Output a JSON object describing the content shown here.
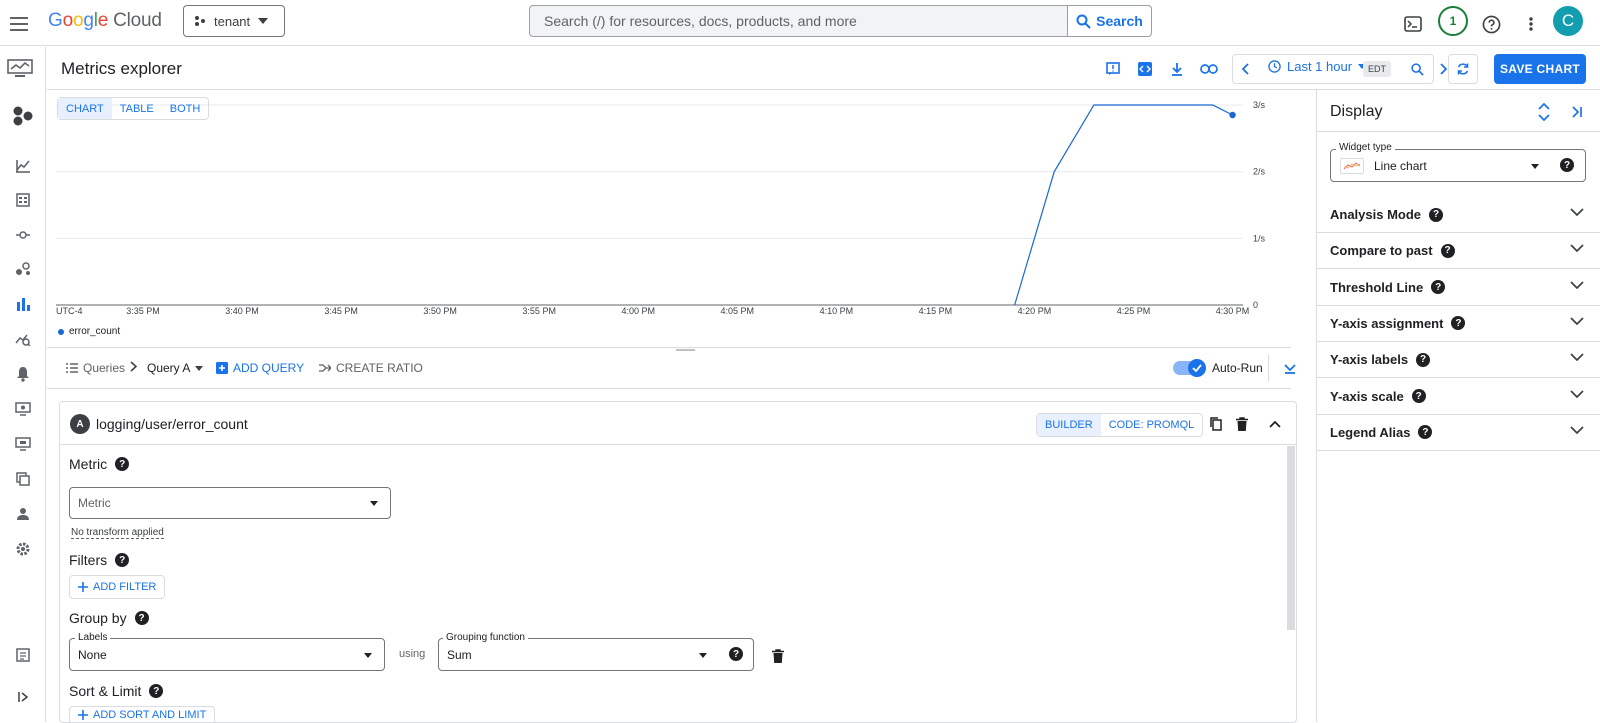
{
  "topbar": {
    "logo_parts": [
      "G",
      "o",
      "o",
      "g",
      "l",
      "e"
    ],
    "logo_cloud": "Cloud",
    "project": "tenant",
    "search_placeholder": "Search (/) for resources, docs, products, and more",
    "search_button": "Search",
    "notification_count": "1",
    "avatar_letter": "C",
    "icons": [
      "menu-icon",
      "terminal-icon",
      "help-icon",
      "more-vert-icon"
    ]
  },
  "rail": {
    "icons": [
      "monitoring-logo-icon",
      "overview-icon",
      "dashboards-icon",
      "metrics-scope-icon",
      "integrations-icon",
      "services-icon",
      "metrics-explorer-icon",
      "slo-icon",
      "alerting-icon",
      "uptime-icon",
      "synthetic-icon",
      "groups-icon",
      "user-icon",
      "settings-icon",
      "release-notes-icon",
      "expand-rail-icon"
    ]
  },
  "header": {
    "title": "Metrics explorer",
    "time_range": "Last 1 hour",
    "timezone": "EDT",
    "save_chart": "SAVE CHART"
  },
  "view_tabs": [
    "CHART",
    "TABLE",
    "BOTH"
  ],
  "chart_data": {
    "type": "line",
    "x": [
      "4:19 PM",
      "4:21 PM",
      "4:23 PM",
      "4:29 PM",
      "4:30 PM"
    ],
    "series": [
      {
        "name": "error_count",
        "values": [
          0,
          2,
          3,
          3,
          2.85
        ]
      }
    ],
    "x_tick_labels": [
      "UTC-4",
      "3:35 PM",
      "3:40 PM",
      "3:45 PM",
      "3:50 PM",
      "3:55 PM",
      "4:00 PM",
      "4:05 PM",
      "4:10 PM",
      "4:15 PM",
      "4:20 PM",
      "4:25 PM",
      "4:30 PM"
    ],
    "y_tick_labels": [
      "3/s",
      "2/s",
      "1/s",
      "0"
    ],
    "ylim": [
      0,
      3
    ],
    "grid": true,
    "legend_position": "bottom-left",
    "color": "#1967d2"
  },
  "query_bar": {
    "queries_label": "Queries",
    "query_name": "Query A",
    "add_query": "ADD QUERY",
    "create_ratio": "CREATE RATIO",
    "auto_run": "Auto-Run"
  },
  "query": {
    "badge": "A",
    "name": "logging/user/error_count",
    "modes": [
      "BUILDER",
      "CODE: PROMQL"
    ],
    "metric_label": "Metric",
    "metric_placeholder": "Metric",
    "transform": "No transform applied",
    "filters_label": "Filters",
    "add_filter": "ADD FILTER",
    "group_by_label": "Group by",
    "labels_field": "Labels",
    "labels_value": "None",
    "using": "using",
    "grouping_field": "Grouping function",
    "grouping_value": "Sum",
    "sort_label": "Sort & Limit",
    "add_sort": "ADD SORT AND LIMIT"
  },
  "display": {
    "title": "Display",
    "widget_type_label": "Widget type",
    "widget_type_value": "Line chart",
    "sections": [
      "Analysis Mode",
      "Compare to past",
      "Threshold Line",
      "Y-axis assignment",
      "Y-axis labels",
      "Y-axis scale",
      "Legend Alias"
    ]
  }
}
